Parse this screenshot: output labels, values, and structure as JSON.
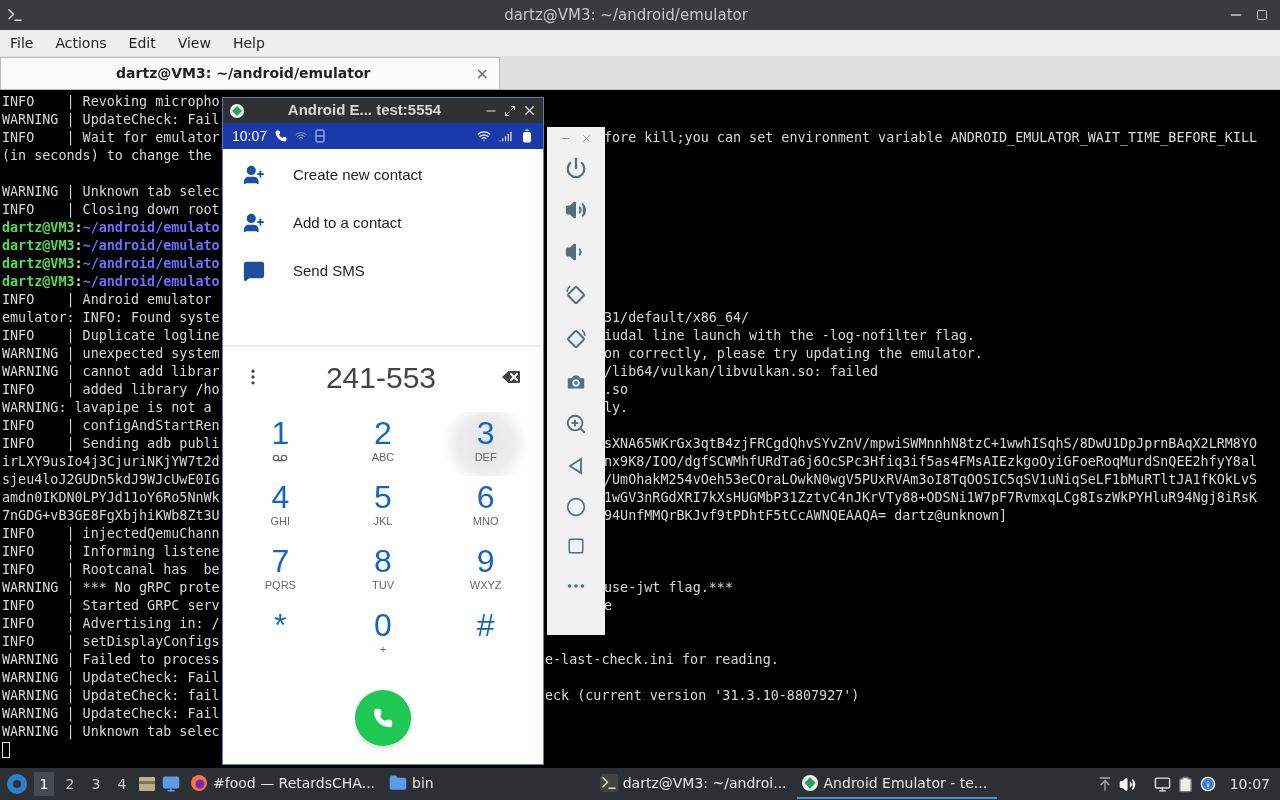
{
  "terminal_window": {
    "title": "dartz@VM3: ~/android/emulator",
    "menu": [
      "File",
      "Actions",
      "Edit",
      "View",
      "Help"
    ],
    "tabs": [
      {
        "label": "dartz@VM3: ~/android/emulator",
        "selected": true,
        "close": "×"
      }
    ],
    "lines": [
      {
        "kind": "log",
        "left": "INFO    | Revoking micropho"
      },
      {
        "kind": "log",
        "left": "WARNING | UpdateCheck: Fail"
      },
      {
        "kind": "log",
        "left": "INFO    | Wait for emulator",
        "right": "fore kill;you can set environment variable ANDROID_EMULATOR_WAIT_TIME_BEFORE_KILL"
      },
      {
        "kind": "log",
        "left": "(in seconds) to change the"
      },
      {
        "kind": "blank"
      },
      {
        "kind": "log",
        "left": "WARNING | Unknown tab selec"
      },
      {
        "kind": "log",
        "left": "INFO    | Closing down root"
      },
      {
        "kind": "prompt",
        "user": "dartz@VM3",
        "sep": ":",
        "path": "~/android/emulato"
      },
      {
        "kind": "prompt",
        "user": "dartz@VM3",
        "sep": ":",
        "path": "~/android/emulato"
      },
      {
        "kind": "prompt",
        "user": "dartz@VM3",
        "sep": ":",
        "path": "~/android/emulato"
      },
      {
        "kind": "prompt",
        "user": "dartz@VM3",
        "sep": ":",
        "path": "~/android/emulato"
      },
      {
        "kind": "log",
        "left": "INFO    | Android emulator"
      },
      {
        "kind": "log",
        "left": "emulator: INFO: Found syste",
        "right": "31/default/x86_64/"
      },
      {
        "kind": "log",
        "left": "INFO    | Duplicate logline",
        "right": "iudal line launch with the -log-nofilter flag."
      },
      {
        "kind": "log",
        "left": "WARNING | unexpected system",
        "right": "on correctly, please try updating the emulator."
      },
      {
        "kind": "log",
        "left": "WARNING | cannot add librar",
        "right": "/lib64/vulkan/libvulkan.so: failed"
      },
      {
        "kind": "log",
        "left": "INFO    | added library /ho",
        "right": ".so"
      },
      {
        "kind": "log",
        "left": "WARNING: lavapipe is not a",
        "right": "ly."
      },
      {
        "kind": "log",
        "left": "INFO    | configAndStartRen"
      },
      {
        "kind": "log",
        "left": "INFO    | Sending adb publi",
        "right": "sXNA65WKrGx3qtB4zjFRCgdQhvSYvZnV/mpwiSWMnnhN8tzC+1wwhISqhS/8DwU1DpJprnBAqX2LRM8YO"
      },
      {
        "kind": "log",
        "left": "irLXY9usIo4j3CjuriNKjYW7t2d",
        "right": "nx9K8/IOO/dgfSCWMhfURdTa6j6OcSPc3Hfiq3if5as4FMsAIEzkgoOyiGFoeRoqMurdSnQEE2hfyY8al"
      },
      {
        "kind": "log",
        "left": "sjeu4loJ2GUDn5kdJ9WJcUwE0IG",
        "right": "/UmOhakM254vOeh53eCOraLOwkN0wgV5PUxRVAm3oI8TqOOSIC5qSV1uNiqSeLF1bMuRTltJA1fKOkLvS"
      },
      {
        "kind": "log",
        "left": "amdn0IKDN0LPYJd11oY6Ro5NnWk",
        "right": "1wGV3nRGdXRI7kXsHUGMbP31ZztvC4nJKrVTy88+ODSNi1W7pF7RvmxqLCg8IszWkPYHluR94Ngj8iRsK"
      },
      {
        "kind": "log",
        "left": "7nGDG+vB3GE8FgXbjhiKWb8Zt3U",
        "right": "94UnfMMQrBKJvf9tPDhtF5tCcAWNQEAAQA= dartz@unknown]"
      },
      {
        "kind": "log",
        "left": "INFO    | injectedQemuChann"
      },
      {
        "kind": "log",
        "left": "INFO    | Informing listene"
      },
      {
        "kind": "log",
        "left": "INFO    | Rootcanal has  be"
      },
      {
        "kind": "log",
        "left": "WARNING | *** No gRPC prote",
        "right": "use-jwt flag.***"
      },
      {
        "kind": "log",
        "left": "INFO    | Started GRPC serv",
        "right": "e"
      },
      {
        "kind": "log",
        "left": "INFO    | Advertising in: /"
      },
      {
        "kind": "log",
        "left": "INFO    | setDisplayConfigs"
      },
      {
        "kind": "log",
        "left": "WARNING | Failed to process",
        "right": "e-last-check.ini for reading."
      },
      {
        "kind": "log",
        "left": "WARNING | UpdateCheck: Fail"
      },
      {
        "kind": "log",
        "left": "WARNING | UpdateCheck: fail",
        "right": "eck (current version '31.3.10-8807927')"
      },
      {
        "kind": "log",
        "left": "WARNING | UpdateCheck: Fail"
      },
      {
        "kind": "log",
        "left": "WARNING | Unknown tab selec"
      },
      {
        "kind": "cursor"
      }
    ]
  },
  "emulator": {
    "title": "Android E... test:5554",
    "status_time": "10:07",
    "menu_items": [
      {
        "label": "Create new contact",
        "kind": "add-person"
      },
      {
        "label": "Add to a contact",
        "kind": "add-person"
      },
      {
        "label": "Send SMS",
        "kind": "message"
      }
    ],
    "dial_number": "241-553",
    "keys": [
      {
        "digit": "1",
        "kind": "voicemail",
        "pressed": false
      },
      {
        "digit": "2",
        "letters": "ABC",
        "kind": "letters",
        "pressed": false
      },
      {
        "digit": "3",
        "letters": "DEF",
        "kind": "letters",
        "pressed": true
      },
      {
        "digit": "4",
        "letters": "GHI",
        "kind": "letters",
        "pressed": false
      },
      {
        "digit": "5",
        "letters": "JKL",
        "kind": "letters",
        "pressed": false
      },
      {
        "digit": "6",
        "letters": "MNO",
        "kind": "letters",
        "pressed": false
      },
      {
        "digit": "7",
        "letters": "PQRS",
        "kind": "letters",
        "pressed": false
      },
      {
        "digit": "8",
        "letters": "TUV",
        "kind": "letters",
        "pressed": false
      },
      {
        "digit": "9",
        "letters": "WXYZ",
        "kind": "letters",
        "pressed": false
      },
      {
        "digit": "*",
        "kind": "plain",
        "pressed": false
      },
      {
        "digit": "0",
        "letters": "+",
        "kind": "letters",
        "pressed": false
      },
      {
        "digit": "#",
        "kind": "plain",
        "pressed": false
      }
    ]
  },
  "taskbar": {
    "workspaces": [
      {
        "label": "1",
        "selected": true
      },
      {
        "label": "2",
        "selected": false
      },
      {
        "label": "3",
        "selected": false
      },
      {
        "label": "4",
        "selected": false
      }
    ],
    "tasks": [
      {
        "label": "#food — RetardsCHA...",
        "kind": "browser",
        "selected": false
      },
      {
        "label": "bin",
        "kind": "folder",
        "selected": false
      },
      {
        "label": "dartz@VM3: ~/androi...",
        "kind": "terminal",
        "selected": false
      },
      {
        "label": "Android Emulator - te...",
        "kind": "emulator",
        "selected": true
      }
    ],
    "clock": "10:07"
  }
}
